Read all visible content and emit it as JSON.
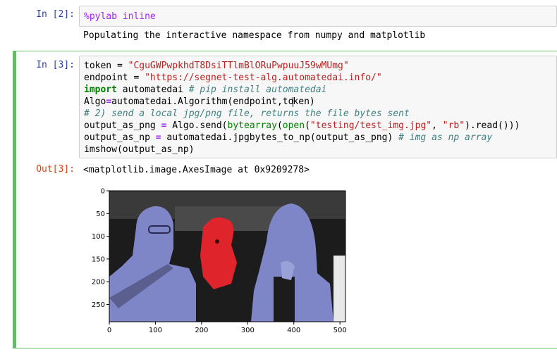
{
  "cells": [
    {
      "prompt": "In [2]:",
      "code": "%pylab inline",
      "stream_output": "Populating the interactive namespace from numpy and matplotlib"
    },
    {
      "prompt": "In [3]:",
      "code_lines": [
        "token = \"CguGWPwpkhdT8DsiTTlmBlORuPwpuuJ59wMUmg\"",
        "endpoint = \"https://segnet-test-alg.automatedai.info/\"",
        "import automatedai # pip install automatedai",
        "Algo=automatedai.Algorithm(endpoint,token)",
        "# 2) send a local jpg/png file, returns the file bytes sent",
        "output_as_png = Algo.send(bytearray(open(\"testing/test_img.jpg\", \"rb\").read()))",
        "output_as_np = automatedai.jpgbytes_to_np(output_as_png) # img as np array",
        "imshow(output_as_np)"
      ],
      "out_prompt": "Out[3]:",
      "result_text": "<matplotlib.image.AxesImage at 0x9209278>"
    }
  ],
  "plot": {
    "xlim": [
      0,
      512
    ],
    "ylim_top_to_bottom": [
      0,
      288
    ],
    "x_ticks": [
      {
        "v": 0,
        "label": "0"
      },
      {
        "v": 100,
        "label": "100"
      },
      {
        "v": 200,
        "label": "200"
      },
      {
        "v": 300,
        "label": "300"
      },
      {
        "v": 400,
        "label": "400"
      },
      {
        "v": 500,
        "label": "500"
      }
    ],
    "y_ticks": [
      {
        "v": 0,
        "label": "0"
      },
      {
        "v": 50,
        "label": "50"
      },
      {
        "v": 100,
        "label": "100"
      },
      {
        "v": 150,
        "label": "150"
      },
      {
        "v": 200,
        "label": "200"
      },
      {
        "v": 250,
        "label": "250"
      }
    ],
    "colors": {
      "person_overlay": "#7f86c8",
      "dog_overlay": "#e0242c",
      "background": "#1c1c1c"
    }
  }
}
